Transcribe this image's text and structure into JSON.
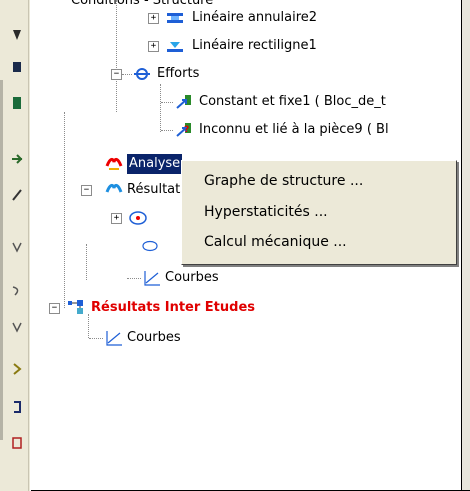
{
  "tree": {
    "header_partial": "Conditions - Structure",
    "nodes": [
      {
        "label": "Linéaire annulaire2"
      },
      {
        "label": "Linéaire rectiligne1"
      },
      {
        "label": "Efforts"
      },
      {
        "label": "Constant et fixe1 ( Bloc_de_t"
      },
      {
        "label": "Inconnu et lié à la pièce9 ( Bl"
      },
      {
        "label": "Analyse"
      },
      {
        "label": "Résultats"
      },
      {
        "label": "Courbes"
      },
      {
        "label": "Résultats Inter Etudes"
      },
      {
        "label": "Courbes"
      }
    ],
    "expander_plus": "+",
    "expander_minus": "−"
  },
  "context_menu": {
    "items": [
      {
        "label": "Graphe de structure ..."
      },
      {
        "label": "Hyperstaticités ..."
      },
      {
        "label": "Calcul mécanique ..."
      }
    ]
  },
  "colors": {
    "selection": "#0a246a",
    "highlight_text": "#e00000",
    "menu_bg": "#ece9d8"
  }
}
